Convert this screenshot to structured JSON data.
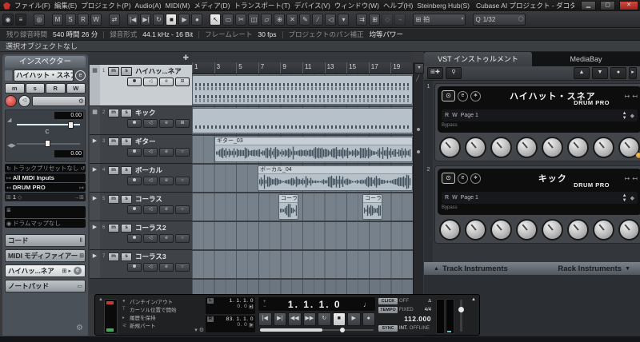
{
  "window": {
    "title": "Cubase AI プロジェクト - ダコタハウスで会いましょう",
    "menus": [
      "ファイル(F)",
      "編集(E)",
      "プロジェクト(P)",
      "Audio(A)",
      "MIDI(M)",
      "メディア(D)",
      "トランスポート(T)",
      "デバイス(V)",
      "ウィンドウ(W)",
      "ヘルプ(H)",
      "Steinberg Hub(S)"
    ]
  },
  "toolbar": {
    "automation_buttons": [
      "M",
      "S",
      "R",
      "W"
    ],
    "grid_type_value": "拍",
    "quantize_label": "Q",
    "quantize_value": "1/32"
  },
  "status_bar": {
    "items": [
      {
        "label": "残り録音時間",
        "value": "540 時間 26 分"
      },
      {
        "label": "録音形式",
        "value": "44.1 kHz - 16 Bit"
      },
      {
        "label": "フレームレート",
        "value": "30 fps"
      },
      {
        "label": "プロジェクトのパン補正",
        "value": "均等パワー"
      }
    ]
  },
  "info_line": "選択オブジェクトなし",
  "inspector": {
    "title": "インスペクター",
    "track_name": "ハイハット・スネア",
    "mute": "m",
    "solo": "s",
    "read": "R",
    "write": "W",
    "volume_value": "0.00",
    "pan_center": "C",
    "pan_value": "0.00",
    "preset_row": "トラックプリセットなし",
    "input_row": "All MIDI Inputs",
    "output_row": "DRUM PRO",
    "channel_value": "1",
    "drum_map_row": "ドラムマップなし",
    "sections": [
      {
        "label": "コード"
      },
      {
        "label": "MIDI モディファイアー"
      },
      {
        "label": "ハイハッ...ネア"
      },
      {
        "label": "ノートパッド"
      }
    ]
  },
  "track_list": {
    "mute": "m",
    "solo": "s",
    "tracks": [
      {
        "num": "1",
        "name": "ハイハッ...ネア"
      },
      {
        "num": "2",
        "name": "キック"
      },
      {
        "num": "3",
        "name": "ギター"
      },
      {
        "num": "4",
        "name": "ボーカル"
      },
      {
        "num": "5",
        "name": "コーラス"
      },
      {
        "num": "6",
        "name": "コーラス2"
      },
      {
        "num": "7",
        "name": "コーラス3"
      }
    ]
  },
  "arrange": {
    "ruler_marks": [
      "1",
      "3",
      "5",
      "7",
      "9",
      "11",
      "13",
      "15",
      "17",
      "19"
    ],
    "events": {
      "guitar": "ギター_03",
      "vocal": "ボーカル_04",
      "chorus1": "コーラ",
      "chorus2": "コーラ"
    }
  },
  "rack": {
    "tabs": [
      "VST インストゥルメント",
      "MediaBay"
    ],
    "slots": [
      {
        "num": "1",
        "name": "ハイハット・スネア",
        "plugin": "DRUM PRO",
        "read": "R",
        "write": "W",
        "page": "Page 1",
        "bypass": "Bypass"
      },
      {
        "num": "2",
        "name": "キック",
        "plugin": "DRUM PRO",
        "read": "R",
        "write": "W",
        "page": "Page 1",
        "bypass": "Bypass"
      }
    ],
    "footer": {
      "left": "Track Instruments",
      "right": "Rack Instruments"
    }
  },
  "transport": {
    "record_modes": [
      "パンチイン/アウト",
      "カーソル位置で開始",
      "履歴を保持",
      "新規パート"
    ],
    "left_label": "L",
    "right_label": "R",
    "left_locator": "1. 1. 1. 0",
    "left_locator_sub": "0. 0",
    "right_locator": "83. 1. 1. 0",
    "right_locator_sub": "0. 0",
    "main_time": "1. 1. 1. 0",
    "click": {
      "label": "CLICK",
      "value": "OFF"
    },
    "tempo": {
      "label": "TEMPO",
      "value": "FIXED",
      "time_sig": "4/4",
      "bpm": "112.000"
    },
    "sync": {
      "label": "SYNC",
      "value": "INT.",
      "status": "OFFLINE"
    }
  },
  "colors": {
    "accent_cyan": "#5bc8d2",
    "record_red": "#d94f48",
    "selected_track_bg": "#c9ced3",
    "led_orange": "#e09a28",
    "close_button_red": "#b8342c"
  }
}
